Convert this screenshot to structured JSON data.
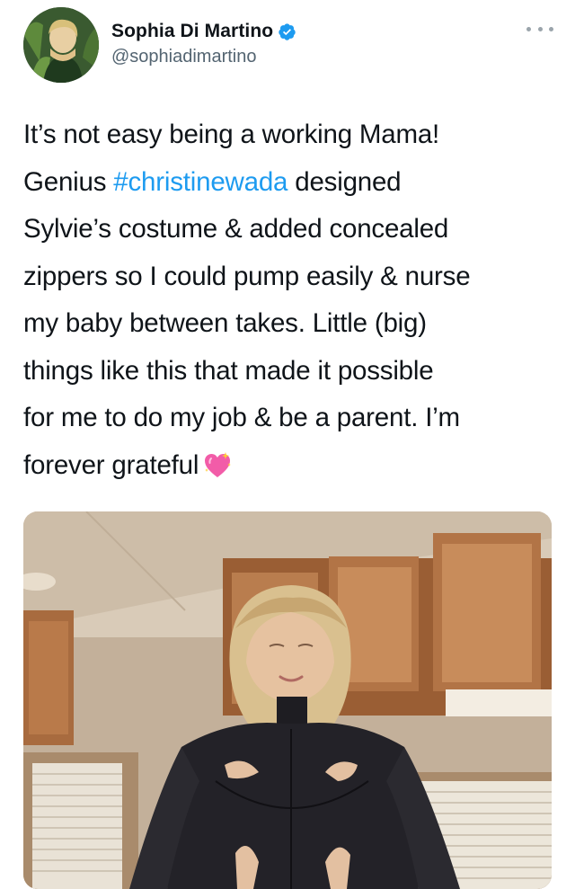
{
  "author": {
    "display_name": "Sophia Di Martino",
    "handle": "@sophiadimartino",
    "verified": true
  },
  "tweet": {
    "line1": "It’s not easy being a working Mama!",
    "line2_before": "Genius ",
    "hashtag": "#christinewada",
    "line2_after": " designed",
    "line3": "Sylvie’s costume & added concealed",
    "line4": "zippers so I could pump easily & nurse",
    "line5": "my baby between takes. Little (big)",
    "line6": "things like this that made it possible",
    "line7": "for me to do my job & be a parent. I’m",
    "line8": "forever grateful",
    "emoji": "sparkling-heart-icon"
  },
  "colors": {
    "text": "#0f1419",
    "secondary_text": "#536471",
    "link": "#1d9bf0",
    "verified": "#1d9bf0"
  },
  "icons": {
    "verified": "verified-badge-icon",
    "more": "more-options-icon"
  }
}
